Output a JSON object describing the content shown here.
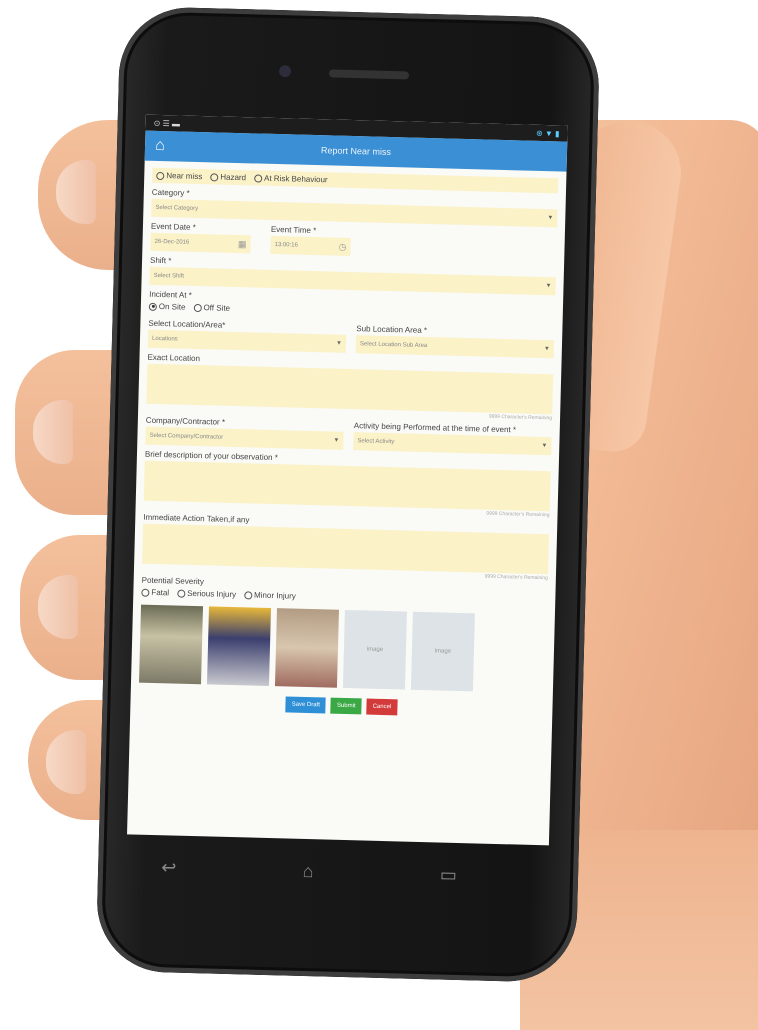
{
  "status": {
    "left": "⊙ ☰ ▬",
    "right": "⊛ ▼ ▮"
  },
  "header": {
    "title": "Report Near miss"
  },
  "observation_types": [
    "Near miss",
    "Hazard",
    "At Risk Behaviour"
  ],
  "category": {
    "label": "Category *",
    "placeholder": "Select Category"
  },
  "event_date": {
    "label": "Event Date *",
    "value": "26-Dec-2016"
  },
  "event_time": {
    "label": "Event Time *",
    "value": "13:00:16"
  },
  "shift": {
    "label": "Shift *",
    "placeholder": "Select Shift"
  },
  "incident_at": {
    "label": "Incident At *",
    "options": [
      "On Site",
      "Off Site"
    ],
    "selected": 0
  },
  "location": {
    "label": "Select Location/Area*",
    "value": "Locations"
  },
  "sub_location": {
    "label": "Sub Location Area *",
    "value": "Select Location Sub Area"
  },
  "exact_location": {
    "label": "Exact Location"
  },
  "counter_text": "9999 Character's Remaining",
  "company": {
    "label": "Company/Contractor *",
    "value": "Select Company/Contractor"
  },
  "activity": {
    "label": "Activity being Performed at the time of event *",
    "value": "Select Activity"
  },
  "brief_description": {
    "label": "Brief description of your observation *"
  },
  "immediate_action": {
    "label": "Immediate Action Taken,if any"
  },
  "severity": {
    "label": "Potential Severity",
    "options": [
      "Fatal",
      "Serious Injury",
      "Minor Injury"
    ]
  },
  "images": {
    "placeholder": "image"
  },
  "buttons": {
    "draft": "Save Draft",
    "submit": "Submit",
    "cancel": "Cancel"
  },
  "android_nav": {
    "back": "↩",
    "home": "⌂",
    "recent": "▭"
  },
  "colors": {
    "header": "#3b8fd4",
    "field_bg": "#fbf2c8",
    "draft": "#2e8fd6",
    "submit": "#3aa845",
    "cancel": "#d33b3b"
  }
}
